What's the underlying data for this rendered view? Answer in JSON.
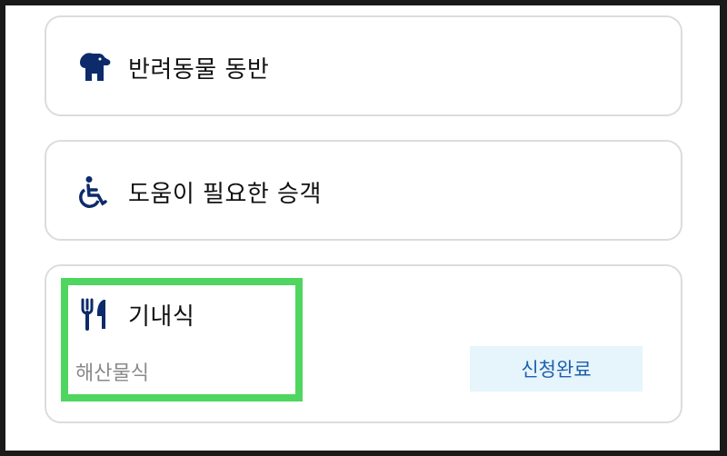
{
  "options": {
    "pet": {
      "label": "반려동물 동반",
      "icon": "dog-icon"
    },
    "assist": {
      "label": "도움이 필요한 승객",
      "icon": "wheelchair-icon"
    },
    "meal": {
      "label": "기내식",
      "icon": "fork-knife-icon",
      "selection": "해산물식",
      "status": "신청완료"
    }
  },
  "colors": {
    "icon": "#0d2a6b",
    "status_bg": "#e6f4fc",
    "status_text": "#1d5fae",
    "highlight": "#4fd660",
    "card_border": "#dcdcdc"
  }
}
